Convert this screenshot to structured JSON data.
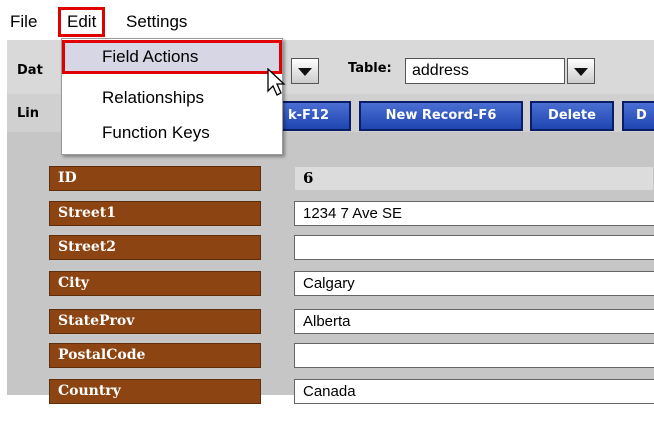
{
  "menubar": {
    "items": [
      {
        "label": "File"
      },
      {
        "label": "Edit"
      },
      {
        "label": "Settings"
      }
    ]
  },
  "edit_menu": {
    "items": [
      {
        "label": "Field Actions",
        "highlighted": true
      },
      {
        "label": "Relationships"
      },
      {
        "label": "Function Keys"
      }
    ]
  },
  "toolbar": {
    "database_label_partial": "Dat",
    "link_label_partial": "Lin",
    "table_label": "Table:",
    "table_value": "address",
    "buttons": {
      "link": "k-F12",
      "new_record": "New Record-F6",
      "delete": "Delete",
      "next_partial": "D"
    }
  },
  "record": {
    "fields": [
      {
        "label": "ID",
        "value": "6",
        "readonly": true
      },
      {
        "label": "Street1",
        "value": "1234 7 Ave  SE"
      },
      {
        "label": "Street2",
        "value": ""
      },
      {
        "label": "City",
        "value": "Calgary"
      },
      {
        "label": "StateProv",
        "value": "Alberta"
      },
      {
        "label": "PostalCode",
        "value": ""
      },
      {
        "label": "Country",
        "value": "Canada"
      }
    ]
  },
  "colors": {
    "highlight_border": "#e00000",
    "field_label_bg": "#8c4512",
    "button_blue": "#2a50c0",
    "panel_gray": "#c6c6c6"
  }
}
